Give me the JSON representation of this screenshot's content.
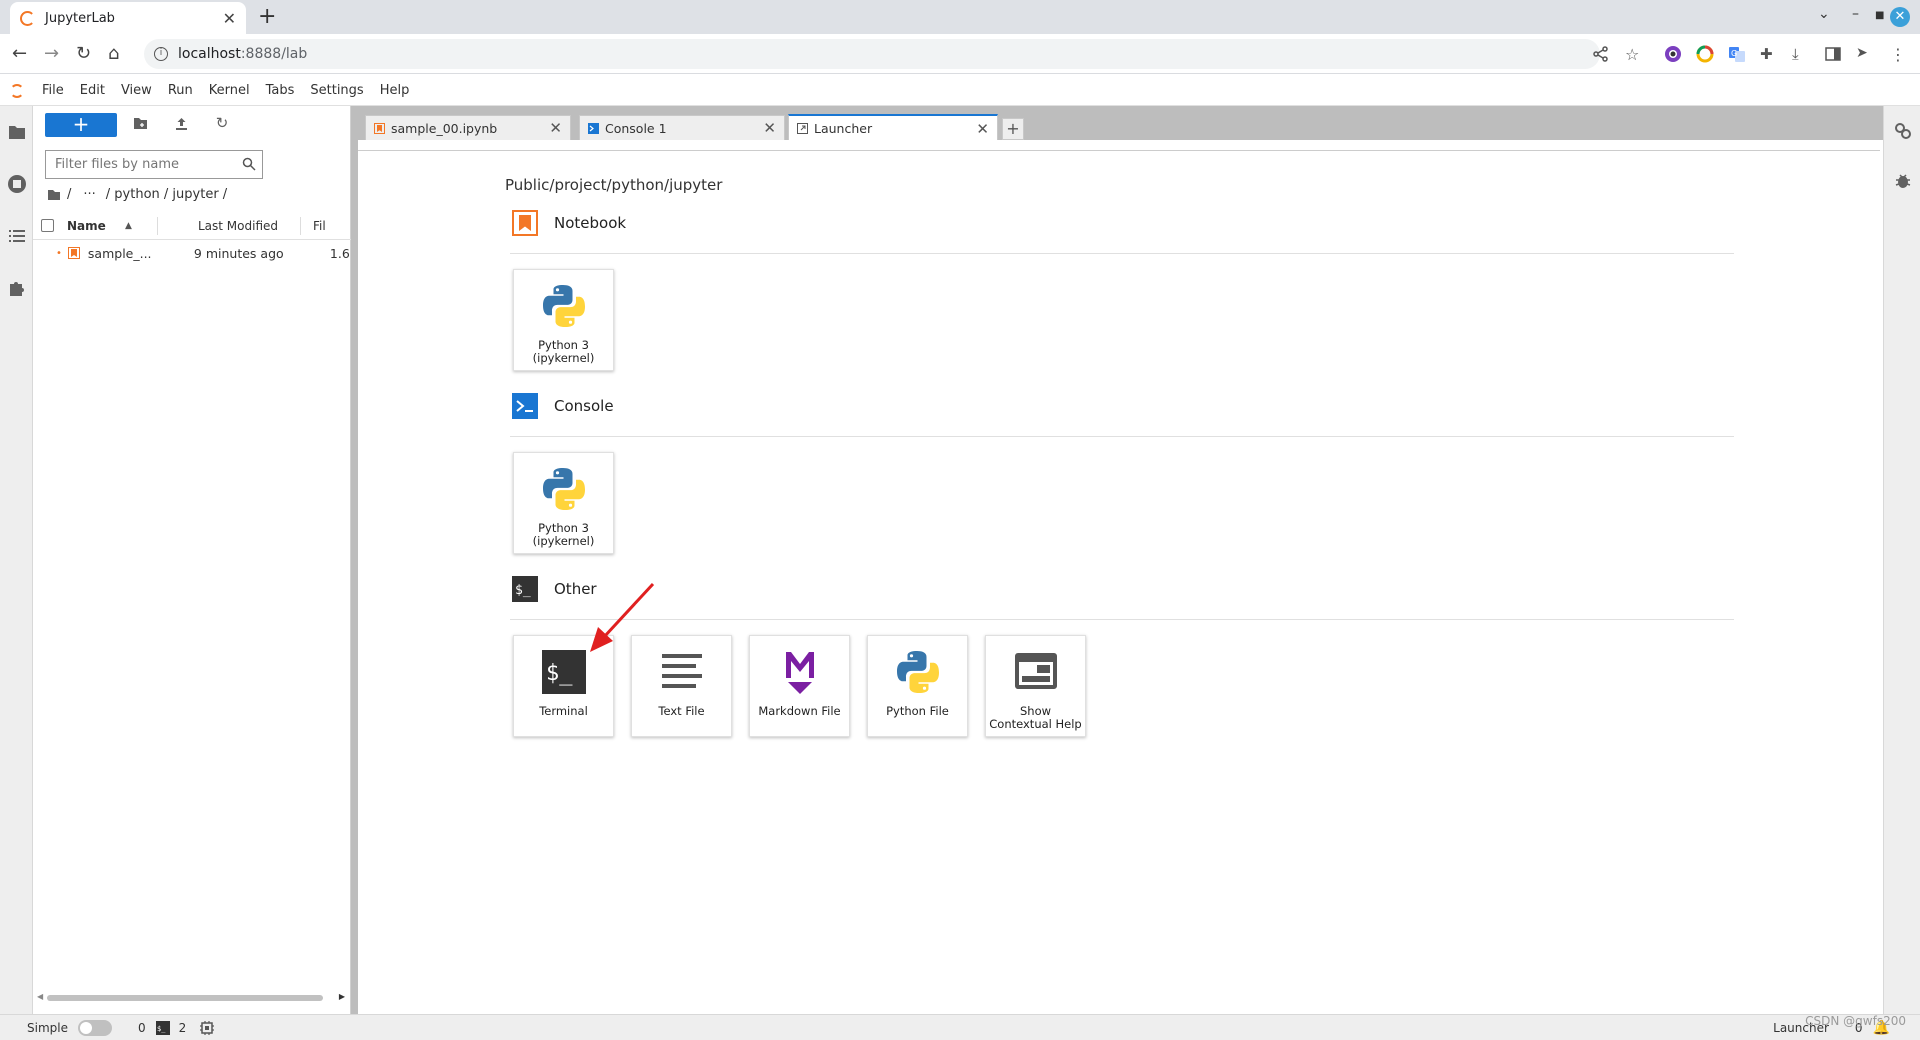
{
  "browser": {
    "tab_title": "JupyterLab",
    "url_host": "localhost",
    "url_rest": ":8888/lab"
  },
  "menubar": {
    "items": [
      "File",
      "Edit",
      "View",
      "Run",
      "Kernel",
      "Tabs",
      "Settings",
      "Help"
    ]
  },
  "filebrowser": {
    "new_button": "+",
    "filter_placeholder": "Filter files by name",
    "breadcrumb": {
      "root": "/",
      "ellipsis": "···",
      "path": "/ python / jupyter /"
    },
    "columns": {
      "name": "Name",
      "last_modified": "Last Modified",
      "file_size": "Fil"
    },
    "files": [
      {
        "name": "sample_...",
        "modified": "9 minutes ago",
        "size": "1.6"
      }
    ]
  },
  "doc_tabs": [
    {
      "label": "sample_00.ipynb",
      "icon": "notebook-icon",
      "active": false
    },
    {
      "label": "Console 1",
      "icon": "console-icon",
      "active": false
    },
    {
      "label": "Launcher",
      "icon": "launcher-icon",
      "active": true
    }
  ],
  "launcher": {
    "cwd": "Public/project/python/jupyter",
    "sections": {
      "notebook": {
        "title": "Notebook",
        "cards": [
          {
            "line1": "Python 3",
            "line2": "(ipykernel)"
          }
        ]
      },
      "console": {
        "title": "Console",
        "cards": [
          {
            "line1": "Python 3",
            "line2": "(ipykernel)"
          }
        ]
      },
      "other": {
        "title": "Other",
        "cards": [
          {
            "label": "Terminal",
            "icon": "terminal-icon"
          },
          {
            "label": "Text File",
            "icon": "text-file-icon"
          },
          {
            "label": "Markdown File",
            "icon": "markdown-icon"
          },
          {
            "label": "Python File",
            "icon": "python-icon"
          },
          {
            "line1": "Show",
            "line2": "Contextual Help",
            "icon": "contextual-help-icon"
          }
        ]
      }
    }
  },
  "statusbar": {
    "mode_label": "Simple",
    "kernels_count": "0",
    "terminals_count": "2",
    "right_label": "Launcher",
    "right_count": "0"
  },
  "watermark": "CSDN @gwfs200",
  "colors": {
    "accent": "#1976d2",
    "jupyter_orange": "#f37726",
    "annotation_arrow": "#e02020"
  }
}
